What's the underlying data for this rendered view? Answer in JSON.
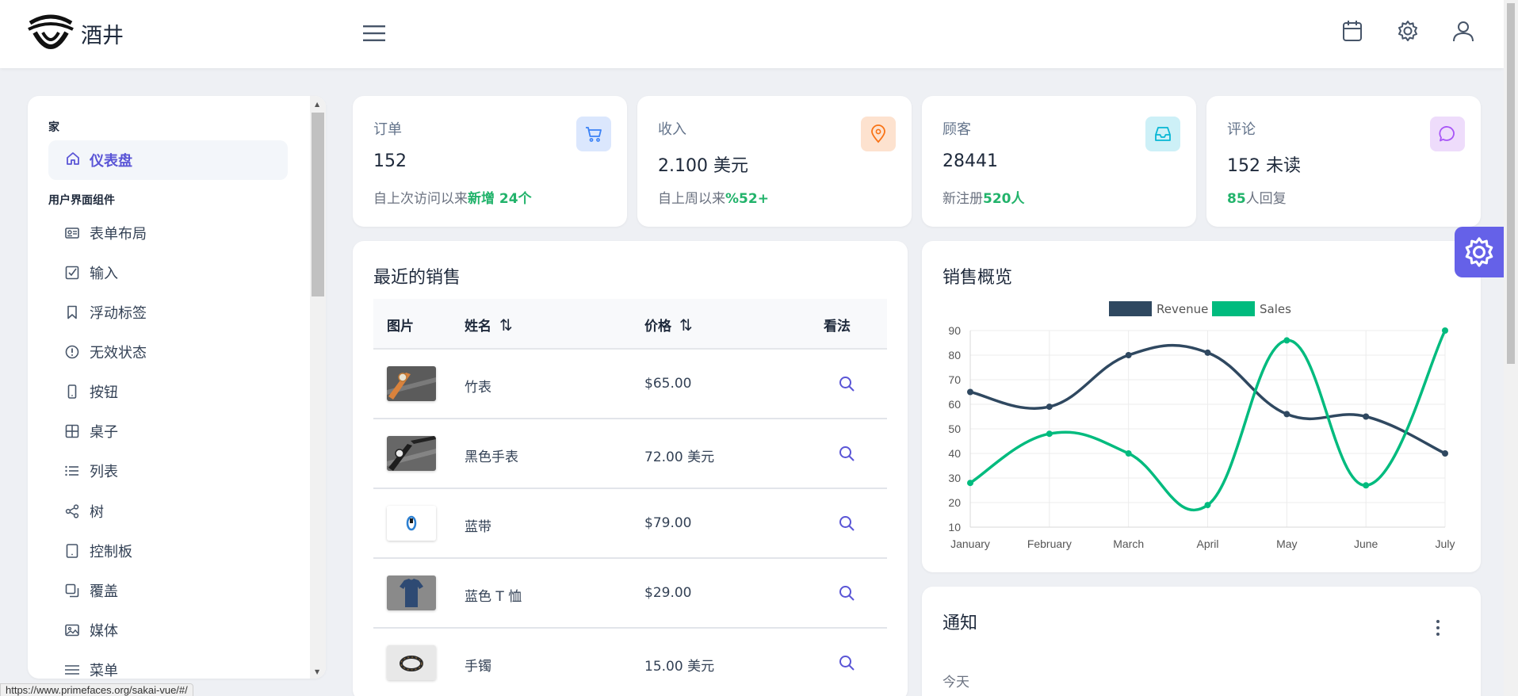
{
  "app": {
    "name": "酒井"
  },
  "topbar": {
    "icons": [
      "menu-icon",
      "calendar-icon",
      "gear-icon",
      "user-icon"
    ]
  },
  "sidebar": {
    "section_home": "家",
    "active_item": "仪表盘",
    "section_ui": "用户界面组件",
    "items": [
      {
        "label": "表单布局",
        "icon": "id-card-icon"
      },
      {
        "label": "输入",
        "icon": "check-square-icon"
      },
      {
        "label": "浮动标签",
        "icon": "bookmark-icon"
      },
      {
        "label": "无效状态",
        "icon": "exclamation-circle-icon"
      },
      {
        "label": "按钮",
        "icon": "mobile-icon"
      },
      {
        "label": "桌子",
        "icon": "table-icon"
      },
      {
        "label": "列表",
        "icon": "list-icon"
      },
      {
        "label": "树",
        "icon": "share-icon"
      },
      {
        "label": "控制板",
        "icon": "tablet-icon"
      },
      {
        "label": "覆盖",
        "icon": "clone-icon"
      },
      {
        "label": "媒体",
        "icon": "image-icon"
      },
      {
        "label": "菜单",
        "icon": "bars-icon"
      }
    ]
  },
  "stats": [
    {
      "label": "订单",
      "value": "152",
      "sub_prefix": "自上次访问以来",
      "sub_highlight": "新增 24个",
      "sub_suffix": "",
      "icon": "shopping-cart-icon",
      "color": "#3b82f6"
    },
    {
      "label": "收入",
      "value": "2.100 美元",
      "sub_prefix": "自上周以来",
      "sub_highlight": "%52+",
      "sub_suffix": "",
      "icon": "map-marker-icon",
      "color": "#f97316"
    },
    {
      "label": "顾客",
      "value": "28441",
      "sub_prefix": "新注册",
      "sub_highlight": "520人",
      "sub_suffix": "",
      "icon": "inbox-icon",
      "color": "#06b6d4"
    },
    {
      "label": "评论",
      "value": "152 未读",
      "sub_prefix": "",
      "sub_highlight": "85",
      "sub_suffix": "人回复",
      "icon": "comment-icon",
      "color": "#a855f7"
    }
  ],
  "sales": {
    "title": "最近的销售",
    "columns": [
      "图片",
      "姓名",
      "价格",
      "看法"
    ],
    "sort_icon": "sort-icon",
    "rows": [
      {
        "name": "竹表",
        "price": "$65.00",
        "image": "bamboo-watch-thumbnail"
      },
      {
        "name": "黑色手表",
        "price": "72.00 美元",
        "image": "black-watch-thumbnail"
      },
      {
        "name": "蓝带",
        "price": "$79.00",
        "image": "blue-band-thumbnail"
      },
      {
        "name": "蓝色 T 恤",
        "price": "$29.00",
        "image": "blue-tshirt-thumbnail"
      },
      {
        "name": "手镯",
        "price": "15.00 美元",
        "image": "bracelet-thumbnail"
      }
    ]
  },
  "overview": {
    "title": "销售概览"
  },
  "chart_data": {
    "type": "line",
    "categories": [
      "January",
      "February",
      "March",
      "April",
      "May",
      "June",
      "July"
    ],
    "series": [
      {
        "name": "Revenue",
        "values": [
          65,
          59,
          80,
          81,
          56,
          55,
          40
        ],
        "color": "#2f4860"
      },
      {
        "name": "Sales",
        "values": [
          28,
          48,
          40,
          19,
          86,
          27,
          90
        ],
        "color": "#00bb7e"
      }
    ],
    "ylim": [
      10,
      90
    ],
    "yticks": [
      10,
      20,
      30,
      40,
      50,
      60,
      70,
      80,
      90
    ],
    "grid": true,
    "legend": "top",
    "title": "",
    "xlabel": "",
    "ylabel": ""
  },
  "notifications": {
    "title": "通知",
    "subtitle": "今天"
  },
  "status_url": "https://www.primefaces.org/sakai-vue/#/"
}
